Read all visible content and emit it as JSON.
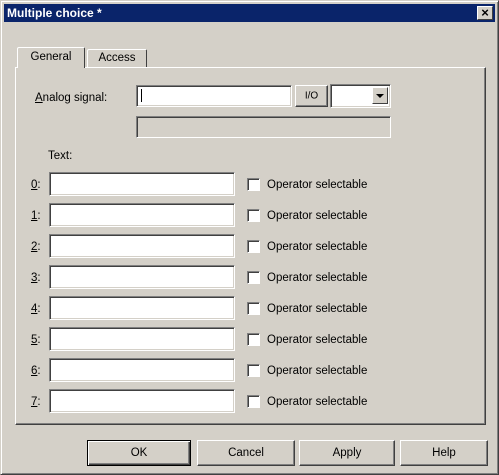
{
  "window": {
    "title": "Multiple choice *",
    "close_symbol": "×"
  },
  "tabs": [
    {
      "label": "General",
      "active": true
    },
    {
      "label": "Access",
      "active": false
    }
  ],
  "analog": {
    "label_u": "A",
    "label_rest": "nalog signal:",
    "value": "",
    "io_button": "I/O",
    "combo_value": "",
    "info_value": ""
  },
  "text_header": "Text:",
  "rows": [
    {
      "index": "0",
      "suffix": ":",
      "value": "",
      "checkbox_label": "Operator selectable",
      "checked": false
    },
    {
      "index": "1",
      "suffix": ":",
      "value": "",
      "checkbox_label": "Operator selectable",
      "checked": false
    },
    {
      "index": "2",
      "suffix": ":",
      "value": "",
      "checkbox_label": "Operator selectable",
      "checked": false
    },
    {
      "index": "3",
      "suffix": ":",
      "value": "",
      "checkbox_label": "Operator selectable",
      "checked": false
    },
    {
      "index": "4",
      "suffix": ":",
      "value": "",
      "checkbox_label": "Operator selectable",
      "checked": false
    },
    {
      "index": "5",
      "suffix": ":",
      "value": "",
      "checkbox_label": "Operator selectable",
      "checked": false
    },
    {
      "index": "6",
      "suffix": ":",
      "value": "",
      "checkbox_label": "Operator selectable",
      "checked": false
    },
    {
      "index": "7",
      "suffix": ":",
      "value": "",
      "checkbox_label": "Operator selectable",
      "checked": false
    }
  ],
  "buttons": {
    "ok": "OK",
    "cancel": "Cancel",
    "apply": "Apply",
    "help": "Help"
  },
  "colors": {
    "face": "#d4d0c8",
    "titlebar": "#0a246a",
    "title_text": "#ffffff",
    "field": "#ffffff"
  }
}
